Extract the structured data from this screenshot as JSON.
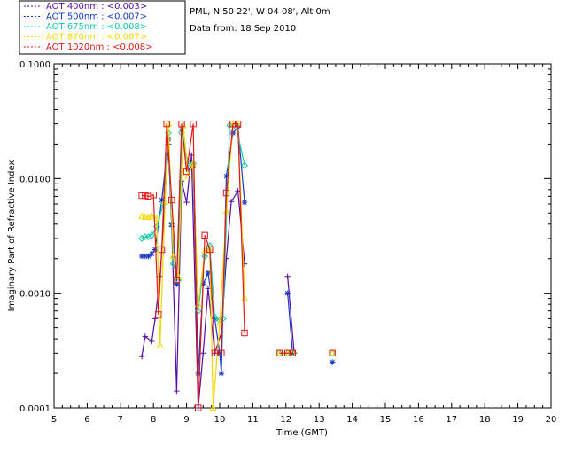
{
  "header": {
    "site": "PML, N 50 22', W 04 08', Alt 0m",
    "date": "Data from: 18 Sep 2010"
  },
  "chart_data": {
    "type": "line",
    "xlabel": "Time (GMT)",
    "ylabel": "Imaginary Part of Refractive Index",
    "xlim": [
      5,
      20
    ],
    "ylim": [
      0.0001,
      0.1
    ],
    "yscale": "log",
    "x_ticks": [
      "5",
      "6",
      "7",
      "8",
      "9",
      "10",
      "11",
      "12",
      "13",
      "14",
      "15",
      "16",
      "17",
      "18",
      "19",
      "20"
    ],
    "y_ticks": [
      "0.0001",
      "0.0010",
      "0.0100",
      "0.1000"
    ],
    "legend_position": "top-left, outside plot",
    "series": [
      {
        "name": "AOT  400nm : <0.003>",
        "label": "AOT  400nm",
        "value_label": "<0.003>",
        "color": "#5a0aa0",
        "marker": "plus",
        "segments": [
          [
            [
              7.65,
              0.00028
            ],
            [
              7.75,
              0.00042
            ],
            [
              7.95,
              0.00038
            ],
            [
              8.05,
              0.0006
            ],
            [
              8.2,
              0.0014
            ],
            [
              8.45,
              0.02
            ],
            [
              8.55,
              0.0038
            ],
            [
              8.7,
              0.00014
            ],
            [
              8.85,
              0.0095
            ],
            [
              9.0,
              0.0062
            ],
            [
              9.15,
              0.016
            ],
            [
              9.35,
              0.0001
            ],
            [
              9.5,
              0.0003
            ],
            [
              9.65,
              0.0011
            ],
            [
              9.85,
              0.0003
            ],
            [
              10.05,
              0.00045
            ],
            [
              10.2,
              0.002
            ],
            [
              10.35,
              0.0063
            ],
            [
              10.55,
              0.0078
            ],
            [
              10.75,
              0.0018
            ]
          ],
          [
            [
              12.05,
              0.0014
            ],
            [
              12.25,
              0.0003
            ]
          ]
        ]
      },
      {
        "name": "AOT  500nm : <0.007>",
        "label": "AOT  500nm",
        "value_label": "<0.007>",
        "color": "#1a38c8",
        "marker": "star",
        "segments": [
          [
            [
              7.65,
              0.0021
            ],
            [
              7.75,
              0.0021
            ],
            [
              7.85,
              0.0021
            ],
            [
              7.95,
              0.0022
            ],
            [
              8.05,
              0.0024
            ],
            [
              8.25,
              0.0065
            ],
            [
              8.45,
              0.022
            ],
            [
              8.55,
              0.004
            ],
            [
              8.7,
              0.0012
            ],
            [
              8.85,
              0.027
            ],
            [
              9.05,
              0.012
            ],
            [
              9.2,
              0.013
            ],
            [
              9.35,
              0.0002
            ],
            [
              9.5,
              0.0012
            ],
            [
              9.65,
              0.0015
            ],
            [
              9.85,
              0.0006
            ],
            [
              10.0,
              0.0003
            ],
            [
              10.05,
              0.0002
            ],
            [
              10.2,
              0.0105
            ],
            [
              10.4,
              0.025
            ],
            [
              10.55,
              0.028
            ],
            [
              10.75,
              0.0062
            ]
          ],
          [
            [
              12.05,
              0.001
            ],
            [
              12.2,
              0.0003
            ]
          ],
          [
            [
              13.4,
              0.00025
            ]
          ]
        ]
      },
      {
        "name": "AOT  675nm : <0.008>",
        "label": "AOT  675nm",
        "value_label": "<0.008>",
        "color": "#14c8a8",
        "marker": "diamond",
        "segments": [
          [
            [
              7.65,
              0.003
            ],
            [
              7.75,
              0.0031
            ],
            [
              7.85,
              0.0031
            ],
            [
              7.95,
              0.0032
            ],
            [
              8.1,
              0.0038
            ],
            [
              8.3,
              0.006
            ],
            [
              8.45,
              0.025
            ],
            [
              8.6,
              0.0018
            ],
            [
              8.75,
              0.0013
            ],
            [
              8.85,
              0.025
            ],
            [
              9.05,
              0.0135
            ],
            [
              9.2,
              0.0135
            ],
            [
              9.35,
              0.0007
            ],
            [
              9.55,
              0.0021
            ],
            [
              9.7,
              0.0026
            ],
            [
              9.85,
              0.00062
            ],
            [
              10.0,
              0.00058
            ],
            [
              10.1,
              0.0006
            ],
            [
              10.3,
              0.029
            ],
            [
              10.5,
              0.028
            ],
            [
              10.75,
              0.013
            ]
          ],
          [
            [
              11.8,
              0.0003
            ],
            [
              12.05,
              0.0003
            ],
            [
              12.2,
              0.0003
            ]
          ],
          [
            [
              13.4,
              0.0003
            ]
          ]
        ]
      },
      {
        "name": "AOT  870nm : <0.007>",
        "label": "AOT  870nm",
        "value_label": "<0.007>",
        "color": "#f0d800",
        "marker": "triangle",
        "segments": [
          [
            [
              7.65,
              0.0047
            ],
            [
              7.75,
              0.0046
            ],
            [
              7.85,
              0.0046
            ],
            [
              7.95,
              0.0047
            ],
            [
              8.1,
              0.0045
            ],
            [
              8.2,
              0.00035
            ],
            [
              8.35,
              0.0063
            ],
            [
              8.45,
              0.03
            ],
            [
              8.6,
              0.0021
            ],
            [
              8.75,
              0.0014
            ],
            [
              8.9,
              0.029
            ],
            [
              9.05,
              0.0105
            ],
            [
              9.2,
              0.0135
            ],
            [
              9.35,
              0.0008
            ],
            [
              9.55,
              0.0023
            ],
            [
              9.7,
              0.0024
            ],
            [
              9.8,
              0.0001
            ],
            [
              10.0,
              0.00055
            ],
            [
              10.2,
              0.0052
            ],
            [
              10.4,
              0.03
            ],
            [
              10.55,
              0.03
            ],
            [
              10.75,
              0.0009
            ]
          ],
          [
            [
              11.8,
              0.0003
            ],
            [
              12.05,
              0.0003
            ],
            [
              12.2,
              0.0003
            ]
          ],
          [
            [
              13.4,
              0.0003
            ]
          ]
        ]
      },
      {
        "name": "AOT 1020nm : <0.008>",
        "label": "AOT 1020nm",
        "value_label": "<0.008>",
        "color": "#e01818",
        "marker": "square",
        "segments": [
          [
            [
              7.65,
              0.0071
            ],
            [
              7.75,
              0.0071
            ],
            [
              7.85,
              0.007
            ],
            [
              8.0,
              0.0072
            ],
            [
              8.15,
              0.00065
            ],
            [
              8.25,
              0.0024
            ],
            [
              8.4,
              0.03
            ],
            [
              8.55,
              0.0065
            ],
            [
              8.7,
              0.0013
            ],
            [
              8.85,
              0.03
            ],
            [
              9.0,
              0.0115
            ],
            [
              9.2,
              0.03
            ],
            [
              9.35,
              0.0001
            ],
            [
              9.55,
              0.0032
            ],
            [
              9.7,
              0.0024
            ],
            [
              9.85,
              0.0003
            ],
            [
              10.05,
              0.0003
            ],
            [
              10.2,
              0.0075
            ],
            [
              10.4,
              0.03
            ],
            [
              10.55,
              0.03
            ],
            [
              10.75,
              0.00045
            ]
          ],
          [
            [
              11.8,
              0.0003
            ],
            [
              12.05,
              0.0003
            ],
            [
              12.2,
              0.0003
            ]
          ],
          [
            [
              13.4,
              0.0003
            ]
          ]
        ]
      }
    ]
  }
}
